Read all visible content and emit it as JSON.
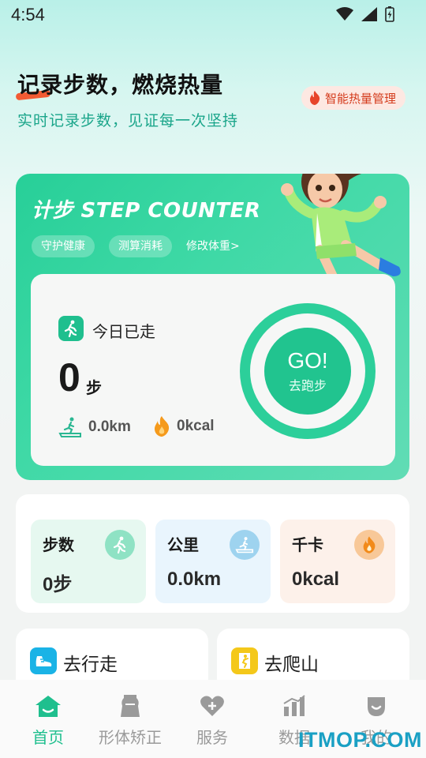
{
  "status_bar": {
    "time": "4:54"
  },
  "hero": {
    "title": "记录步数，燃烧热量",
    "subtitle": "实时记录步数，见证每一次坚持",
    "badge": "智能热量管理"
  },
  "step_card": {
    "title": "计步 STEP COUNTER",
    "chips": [
      "守护健康",
      "测算消耗"
    ],
    "edit_weight_link": "修改体重>",
    "today_label": "今日已走",
    "steps_value": "0",
    "steps_unit": "步",
    "distance": "0.0km",
    "calories": "0kcal",
    "go_label": "GO!",
    "go_sublabel": "去跑步"
  },
  "stats": [
    {
      "label": "步数",
      "value": "0步",
      "icon": "walk-icon",
      "bg": "#e6f8f0",
      "icon_bg": "#8fe2c4"
    },
    {
      "label": "公里",
      "value": "0.0km",
      "icon": "treadmill-icon",
      "bg": "#e9f5fd",
      "icon_bg": "#9ed3ef"
    },
    {
      "label": "千卡",
      "value": "0kcal",
      "icon": "flame-icon",
      "bg": "#fdf1ea",
      "icon_bg": "#f8c898"
    }
  ],
  "actions": [
    {
      "label": "去行走",
      "icon": "shoe-icon",
      "color": "#1ab3e6"
    },
    {
      "label": "去爬山",
      "icon": "climb-icon",
      "color": "#f4c81a"
    }
  ],
  "tabs": [
    {
      "label": "首页",
      "icon": "home-icon",
      "active": true
    },
    {
      "label": "形体矫正",
      "icon": "body-icon",
      "active": false
    },
    {
      "label": "服务",
      "icon": "heart-plus-icon",
      "active": false
    },
    {
      "label": "数据",
      "icon": "chart-icon",
      "active": false
    },
    {
      "label": "我的",
      "icon": "profile-icon",
      "active": false
    }
  ],
  "watermark": "ITMOP.COM",
  "colors": {
    "accent": "#21c48f",
    "badge_text": "#d43b1c",
    "subtitle": "#1aa58a"
  }
}
